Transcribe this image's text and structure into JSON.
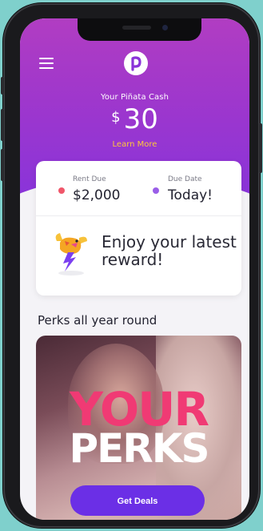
{
  "header": {
    "menu_icon": "hamburger-menu-icon",
    "logo_letter": "p",
    "cash_label": "Your Piñata Cash",
    "currency": "$",
    "cash_amount": "30",
    "learn_more": "Learn More"
  },
  "rent_card": {
    "rent_due_label": "Rent Due",
    "rent_due_value": "$2,000",
    "due_date_label": "Due Date",
    "due_date_value": "Today!",
    "reward_icon": "flying-pinata-lightning-icon",
    "reward_text": "Enjoy your latest reward!"
  },
  "perks": {
    "section_title": "Perks all year round",
    "banner_line1": "YOUR",
    "banner_line2": "PERKS",
    "button_label": "Get Deals"
  },
  "colors": {
    "header_top": "#b13dc2",
    "header_bottom": "#8a34d9",
    "accent_yellow": "#ffc83a",
    "rent_dot": "#f0566a",
    "due_dot": "#9a5ee8",
    "banner_pink": "#f03a74",
    "button_purple": "#6b2fe6",
    "backdrop": "#7fd0cc"
  }
}
